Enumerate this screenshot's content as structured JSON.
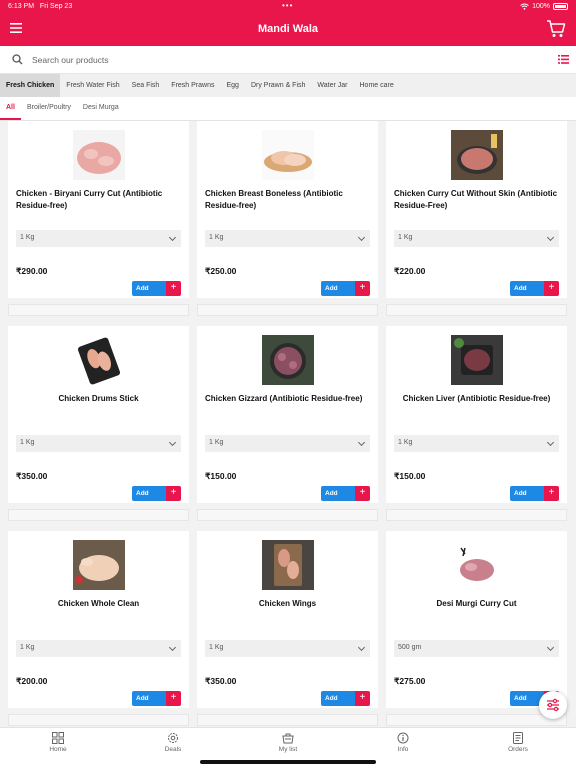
{
  "status": {
    "time": "6:13 PM",
    "date": "Fri Sep 23",
    "battery": "100%"
  },
  "header": {
    "title": "Mandi Wala"
  },
  "search": {
    "placeholder": "Search our products"
  },
  "categories": [
    "Fresh Chicken",
    "Fresh Water Fish",
    "Sea Fish",
    "Fresh Prawns",
    "Egg",
    "Dry Prawn & Fish",
    "Water Jar",
    "Home care"
  ],
  "active_category": "Fresh Chicken",
  "subcategories": [
    "All",
    "Broiler/Poultry",
    "Desi Murga"
  ],
  "active_subcategory": "All",
  "products": [
    {
      "name": "Chicken - Biryani Curry Cut (Antibiotic Residue-free)",
      "qty": "1 Kg",
      "price": "₹290.00",
      "add": "Add",
      "image_color": "#e9a8a4"
    },
    {
      "name": "Chicken Breast Boneless  (Antibiotic Residue-free)",
      "qty": "1 Kg",
      "price": "₹250.00",
      "add": "Add",
      "image_color": "#f1c6a8"
    },
    {
      "name": "Chicken Curry Cut Without Skin (Antibiotic Residue-Free)",
      "qty": "1 Kg",
      "price": "₹220.00",
      "add": "Add",
      "image_color": "#c9786f"
    },
    {
      "name": "Chicken Drums Stick",
      "qty": "1 Kg",
      "price": "₹350.00",
      "add": "Add",
      "image_color": "#e6a98f"
    },
    {
      "name": "Chicken Gizzard (Antibiotic Residue-free)",
      "qty": "1 Kg",
      "price": "₹150.00",
      "add": "Add",
      "image_color": "#8a5061"
    },
    {
      "name": "Chicken Liver (Antibiotic Residue-free)",
      "qty": "1 Kg",
      "price": "₹150.00",
      "add": "Add",
      "image_color": "#7a3a44"
    },
    {
      "name": "Chicken Whole Clean",
      "qty": "1 Kg",
      "price": "₹200.00",
      "add": "Add",
      "image_color": "#f0d1b8"
    },
    {
      "name": "Chicken Wings",
      "qty": "1 Kg",
      "price": "₹350.00",
      "add": "Add",
      "image_color": "#d89a86"
    },
    {
      "name": "Desi Murgi Curry Cut",
      "qty": "500 gm",
      "price": "₹275.00",
      "add": "Add",
      "image_color": "#c7808c"
    }
  ],
  "nav": [
    {
      "label": "Home",
      "icon": "home-grid-icon"
    },
    {
      "label": "Deals",
      "icon": "deals-gear-icon"
    },
    {
      "label": "My list",
      "icon": "my-list-icon"
    },
    {
      "label": "Info",
      "icon": "info-icon"
    },
    {
      "label": "Orders",
      "icon": "orders-icon"
    }
  ],
  "colors": {
    "brand": "#e8164b",
    "add_button": "#1e88e5"
  }
}
